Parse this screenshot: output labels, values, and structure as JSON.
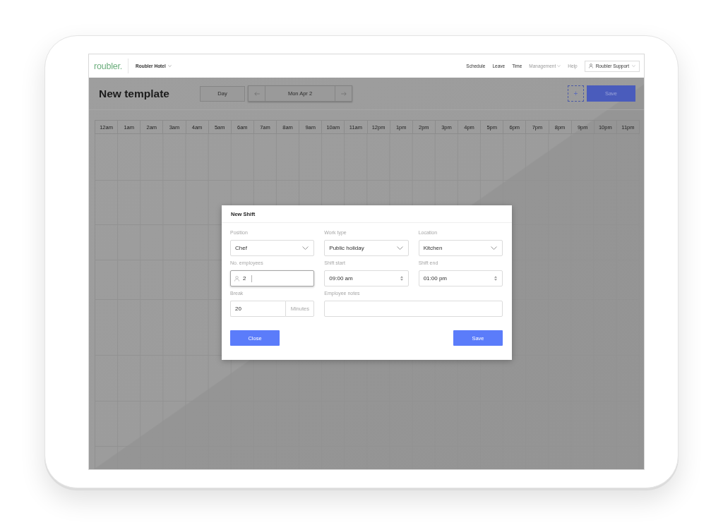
{
  "nav": {
    "logo": "roubler.",
    "workspace": "Roubler Hotel",
    "links": [
      {
        "label": "Schedule",
        "kind": "link",
        "muted": false
      },
      {
        "label": "Leave",
        "kind": "link",
        "muted": false
      },
      {
        "label": "Time",
        "kind": "link",
        "muted": false
      },
      {
        "label": "Management",
        "kind": "menu",
        "muted": true
      },
      {
        "label": "Help",
        "kind": "link",
        "muted": true
      }
    ],
    "user": "Roubler Support"
  },
  "toolbar": {
    "title": "New template",
    "view": "Day",
    "date": "Mon Apr 2",
    "add": "+",
    "save": "Save"
  },
  "grid": {
    "hours": [
      "12am",
      "1am",
      "2am",
      "3am",
      "4am",
      "5am",
      "6am",
      "7am",
      "8am",
      "9am",
      "10am",
      "11am",
      "12pm",
      "1pm",
      "2pm",
      "3pm",
      "4pm",
      "5pm",
      "6pm",
      "7pm",
      "8pm",
      "9pm",
      "10pm",
      "11pm"
    ]
  },
  "dialog": {
    "title": "New Shift",
    "fields": [
      {
        "label": "Position",
        "kind": "select",
        "value": "Chef",
        "focused": false
      },
      {
        "label": "Work type",
        "kind": "select",
        "value": "Public holiday",
        "focused": false
      },
      {
        "label": "Location",
        "kind": "select",
        "value": "Kitchen",
        "focused": false
      },
      {
        "label": "No. employees",
        "kind": "count",
        "value": "2",
        "focused": true
      },
      {
        "label": "Shift start",
        "kind": "time",
        "value": "09:00 am",
        "focused": false
      },
      {
        "label": "Shift end",
        "kind": "time",
        "value": "01:00 pm",
        "focused": false
      },
      {
        "label": "Break",
        "kind": "duration",
        "value": "20",
        "unit": "Minutes",
        "focused": false
      },
      {
        "label": "Employee notes",
        "kind": "text",
        "focused": false
      }
    ],
    "buttons": [
      {
        "label": "Close"
      },
      {
        "label": "Save"
      }
    ]
  }
}
